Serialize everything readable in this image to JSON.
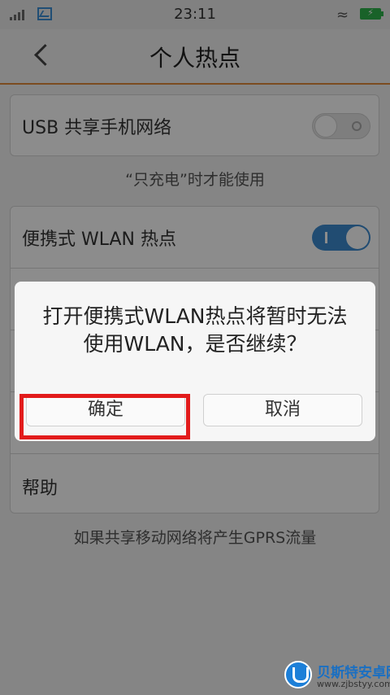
{
  "status_bar": {
    "time": "23:11",
    "icons": [
      "signal-icon",
      "gallery-icon",
      "wifi-icon",
      "battery-charging-icon"
    ]
  },
  "header": {
    "title": "个人热点",
    "back_icon": "chevron-left-icon"
  },
  "usb_card": {
    "label": "USB 共享手机网络",
    "toggle_on": false,
    "note": "“只充电”时才能使用"
  },
  "wlan_card": {
    "label": "便携式 WLAN 热点",
    "toggle_on": true
  },
  "help": {
    "label": "帮助"
  },
  "footer_note": "如果共享移动网络将产生GPRS流量",
  "dialog": {
    "message_line1": "打开便携式WLAN热点将暂时无法",
    "message_line2": "使用WLAN，是否继续？",
    "confirm_label": "确定",
    "cancel_label": "取消"
  },
  "colors": {
    "accent": "#3d8bd0",
    "header_line": "#e08a3b",
    "highlight": "#e21b1b"
  },
  "watermark": {
    "name": "贝斯特安卓网",
    "url": "www.zjbstyy.com"
  }
}
